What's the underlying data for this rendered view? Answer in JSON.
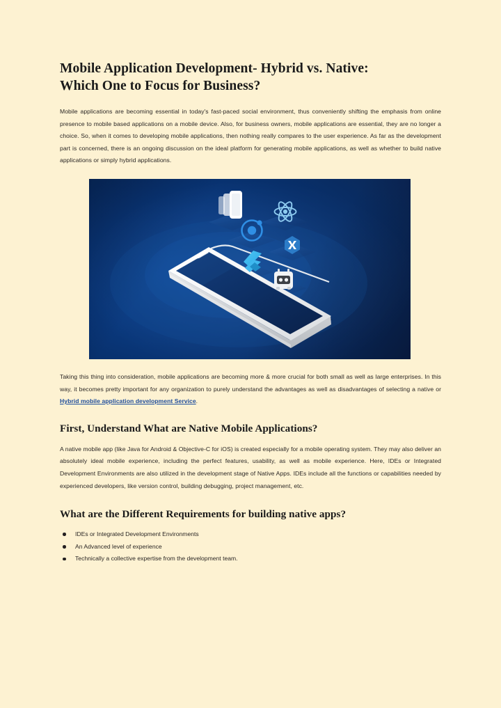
{
  "page": {
    "background_color": "#fdf2d2",
    "text_color": "#2b2725",
    "link_color": "#1f4e9c"
  },
  "article": {
    "title_line1": "Mobile Application Development- Hybrid vs. Native:",
    "title_line2": "Which One to Focus for Business?",
    "paragraph_1": "Mobile applications are becoming essential in today's fast-paced social environment, thus conveniently shifting the emphasis from online presence to mobile based applications on a mobile device. Also, for business owners, mobile applications are essential, they are no longer a choice. So, when it comes to developing mobile applications, then nothing really compares to the user experience. As far as the development part is concerned, there is an ongoing discussion on the ideal platform for generating mobile applications, as well as whether to build native applications or simply hybrid applications.",
    "paragraph_2_before_link": "Taking this thing into consideration, mobile applications are becoming more & more crucial for both small as well as large enterprises. In this way, it becomes pretty important for any organization to purely understand the advantages as well as disadvantages of selecting a native or ",
    "paragraph_2_link": "Hybrid mobile application development Service",
    "paragraph_2_after_link": ".",
    "heading_1": "First, Understand What are Native Mobile Applications?",
    "paragraph_3": "A native mobile app (like Java for Android & Objective-C for iOS) is created especially for a mobile operating system. They may also deliver an absolutely ideal mobile experience, including the perfect features, usability, as well as mobile experience. Here, IDEs or Integrated Development Environments are also utilized in the development stage of Native Apps. IDEs include all the functions or capabilities needed by experienced developers, like version control, building debugging, project management, etc.",
    "heading_2": "What are the Different Requirements for building native apps?",
    "bullets": [
      "IDEs or Integrated Development Environments",
      "An Advanced level of experience",
      "Technically a collective expertise from the development team."
    ]
  },
  "figure": {
    "alt": "Isometric white smartphone on dark blue background with floating mobile framework logos",
    "background_colors": [
      "#0c4391",
      "#08306c",
      "#111c3f"
    ],
    "icons": [
      {
        "name": "app-screens-icon",
        "label": "Stacked app screens"
      },
      {
        "name": "ionic-logo-icon",
        "label": "Ionic"
      },
      {
        "name": "react-logo-icon",
        "label": "React"
      },
      {
        "name": "xamarin-logo-icon",
        "label": "Xamarin"
      },
      {
        "name": "flutter-logo-icon",
        "label": "Flutter"
      },
      {
        "name": "android-robot-icon",
        "label": "Android"
      }
    ],
    "device": {
      "name": "smartphone",
      "body_color": "#f2f3f4",
      "screen_color": "#0b2e63"
    }
  }
}
